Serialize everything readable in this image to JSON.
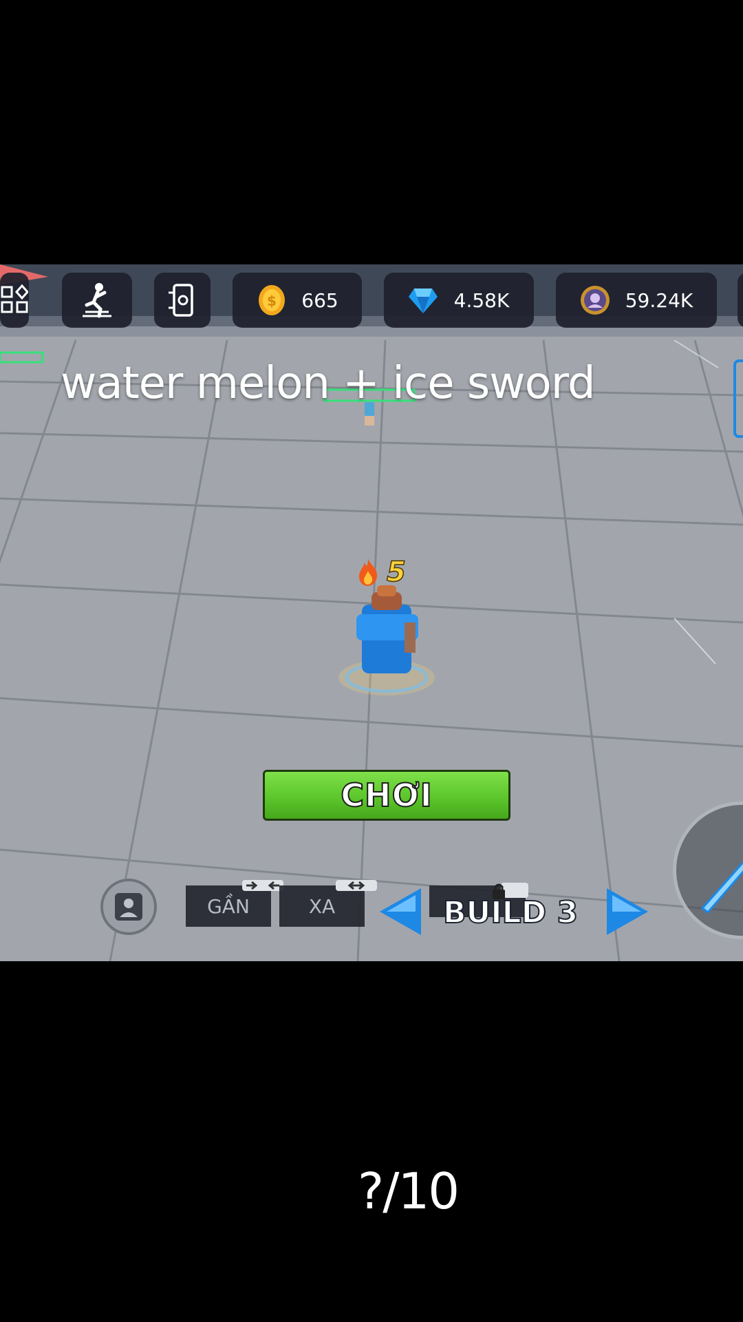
{
  "hud": {
    "coins": "665",
    "gems": "4.58K",
    "tokens": "59.24K"
  },
  "overlay": {
    "caption": "water melon + ice sword",
    "rating": "?/10"
  },
  "player": {
    "streak": "5"
  },
  "controls": {
    "play_label": "CHƠI",
    "near_label": "GẦN",
    "far_label": "XA",
    "build_label": "BUILD 3"
  },
  "colors": {
    "play_button": "#5cc62c",
    "arrow": "#1e88e5",
    "hud_panel": "#1e222c"
  },
  "icons": [
    "grid-menu-icon",
    "emote-icon",
    "device-settings-icon",
    "coin-icon",
    "gem-icon",
    "token-icon",
    "fire-icon",
    "avatar-icon",
    "lock-icon",
    "sword-icon"
  ]
}
